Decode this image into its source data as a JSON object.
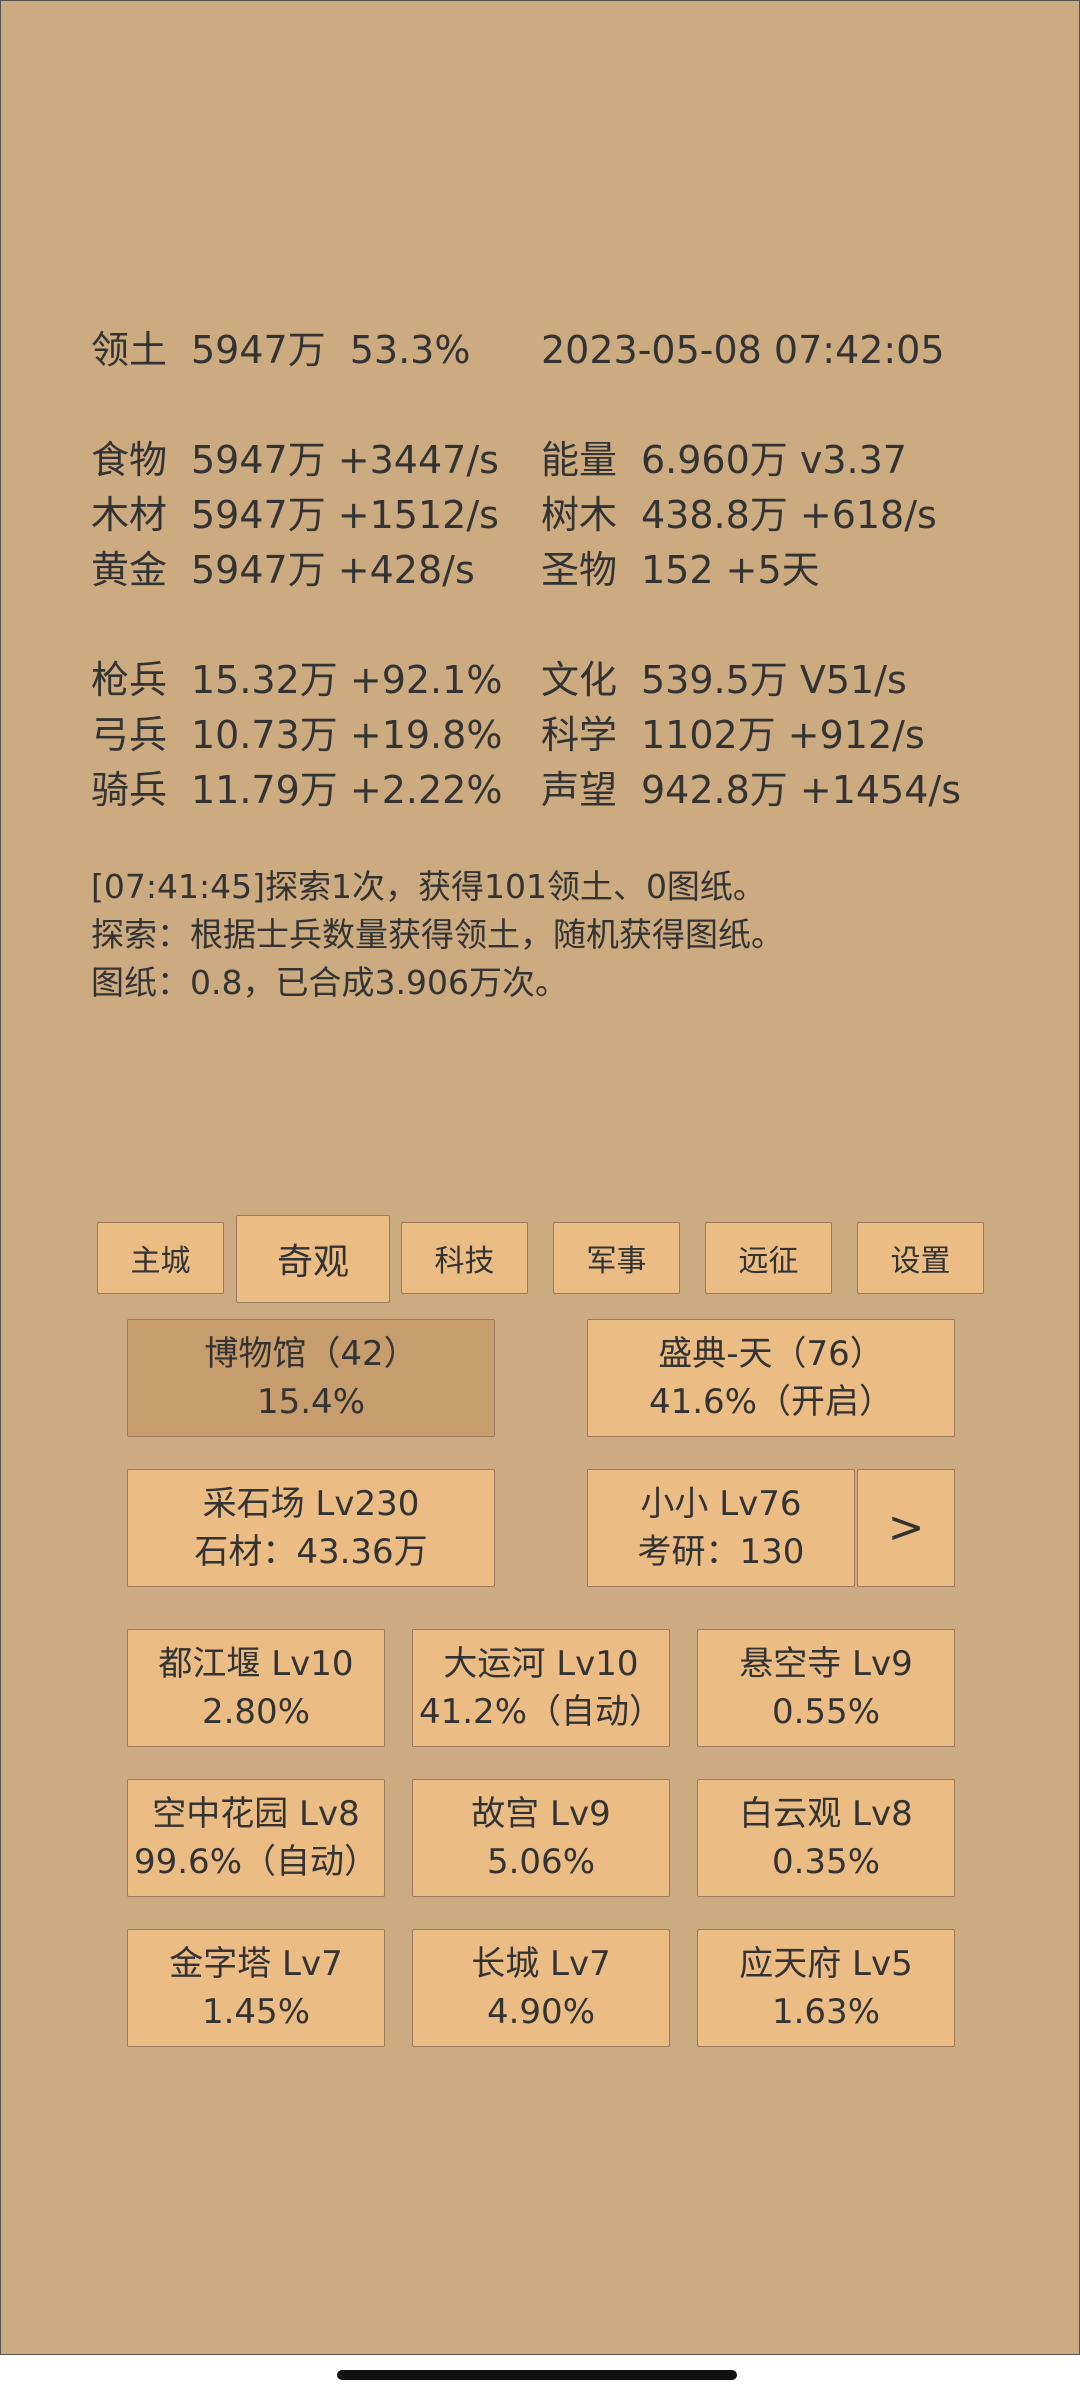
{
  "status": {
    "territory": {
      "label": "领土",
      "value": "5947万",
      "extra": "53.3%"
    },
    "datetime": "2023-05-08 07:42:05"
  },
  "resources_left": [
    {
      "label": "食物",
      "value": "5947万 +3447/s"
    },
    {
      "label": "木材",
      "value": "5947万 +1512/s"
    },
    {
      "label": "黄金",
      "value": "5947万 +428/s"
    }
  ],
  "resources_right": [
    {
      "label": "能量",
      "value": "6.960万  v3.37"
    },
    {
      "label": "树木",
      "value": "438.8万 +618/s"
    },
    {
      "label": "圣物",
      "value": "152 +5天"
    }
  ],
  "troops_left": [
    {
      "label": "枪兵",
      "value": "15.32万 +92.1%"
    },
    {
      "label": "弓兵",
      "value": "10.73万 +19.8%"
    },
    {
      "label": "骑兵",
      "value": "11.79万 +2.22%"
    }
  ],
  "troops_right": [
    {
      "label": "文化",
      "value": "539.5万 V51/s"
    },
    {
      "label": "科学",
      "value": "1102万 +912/s"
    },
    {
      "label": "声望",
      "value": "942.8万 +1454/s"
    }
  ],
  "log": [
    "[07:41:45]探索1次，获得101领土、0图纸。",
    "探索：根据士兵数量获得领土，随机获得图纸。",
    "图纸：0.8，已合成3.906万次。"
  ],
  "tabs": [
    "主城",
    "奇观",
    "科技",
    "军事",
    "远征",
    "设置"
  ],
  "active_tab": "奇观",
  "featured": [
    {
      "line1": "博物馆（42）",
      "line2": "15.4%"
    },
    {
      "line1": "盛典-天（76）",
      "line2": "41.6%（开启）"
    },
    {
      "line1": "采石场 Lv230",
      "line2": "石材：43.36万"
    },
    {
      "line1": "小小 Lv76",
      "line2": "考研：130"
    }
  ],
  "next_label": ">",
  "wonders": [
    {
      "line1": "都江堰 Lv10",
      "line2": "2.80%"
    },
    {
      "line1": "大运河 Lv10",
      "line2": "41.2%（自动）"
    },
    {
      "line1": "悬空寺 Lv9",
      "line2": "0.55%"
    },
    {
      "line1": "空中花园 Lv8",
      "line2": "99.6%（自动）"
    },
    {
      "line1": "故宫 Lv9",
      "line2": "5.06%"
    },
    {
      "line1": "白云观 Lv8",
      "line2": "0.35%"
    },
    {
      "line1": "金字塔 Lv7",
      "line2": "1.45%"
    },
    {
      "line1": "长城 Lv7",
      "line2": "4.90%"
    },
    {
      "line1": "应天府 Lv5",
      "line2": "1.63%"
    }
  ],
  "colors": {
    "background": "#cdab80",
    "button": "#ebbd84",
    "button_selected": "#c89d6d",
    "text": "#333333"
  }
}
